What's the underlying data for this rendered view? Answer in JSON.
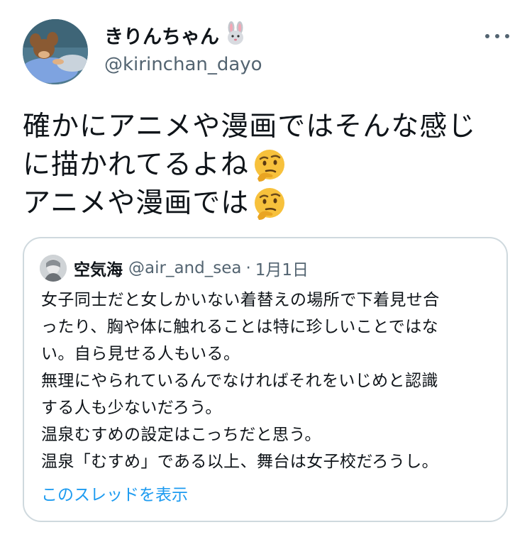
{
  "author": {
    "display_name": "きりんちゃん",
    "handle": "@kirinchan_dayo",
    "name_emoji": "rabbit-face-emoji"
  },
  "more_icon": "more-options-icon",
  "tweet": {
    "lines": [
      "確かにアニメや漫画ではそんな感じ",
      "に描かれてるよね",
      "アニメや漫画では"
    ],
    "emoji": "thinking-face-emoji"
  },
  "quoted_tweet": {
    "display_name": "空気海",
    "handle": "@air_and_sea",
    "separator": "·",
    "date": "1月1日",
    "lines": [
      "女子同士だと女しかいない着替えの場所で下着見せ合",
      "ったり、胸や体に触れることは特に珍しいことではな",
      "い。自ら見せる人もいる。",
      "無理にやられているんでなければそれをいじめと認識",
      "する人も少ないだろう。",
      "温泉むすめの設定はこっちだと思う。",
      "温泉「むすめ」である以上、舞台は女子校だろうし。"
    ],
    "show_thread": "このスレッドを表示"
  },
  "colors": {
    "text": "#0f1419",
    "secondary": "#536471",
    "link": "#1d9bf0",
    "border": "#cfd9de"
  }
}
